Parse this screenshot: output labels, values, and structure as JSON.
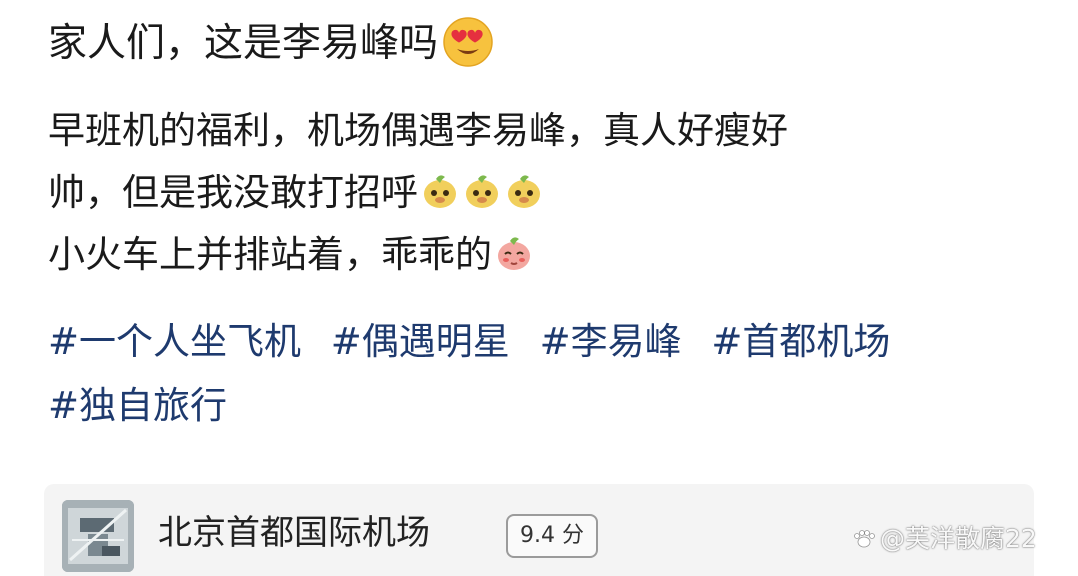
{
  "post": {
    "title": "家人们，这是李易峰吗",
    "title_emoji": "heart-eyes-emoji",
    "lines": [
      {
        "text": "早班机的福利，机场偶遇李易峰，真人好瘦好"
      },
      {
        "text": "帅，但是我没敢打招呼",
        "stickers": [
          "peach-face-sticker",
          "peach-face-sticker",
          "peach-face-sticker"
        ]
      },
      {
        "text": "小火车上并排站着，乖乖的",
        "stickers": [
          "shy-peach-sticker"
        ]
      }
    ],
    "tags": [
      "#一个人坐飞机",
      "#偶遇明星",
      "#李易峰",
      "#首都机场",
      "#独自旅行"
    ]
  },
  "location_card": {
    "name": "北京首都国际机场",
    "score": "9.4 分",
    "thumbnail_icon": "airport-map-thumbnail"
  },
  "watermark": {
    "text": "@芙洋散腐22",
    "icon": "paw-icon"
  }
}
